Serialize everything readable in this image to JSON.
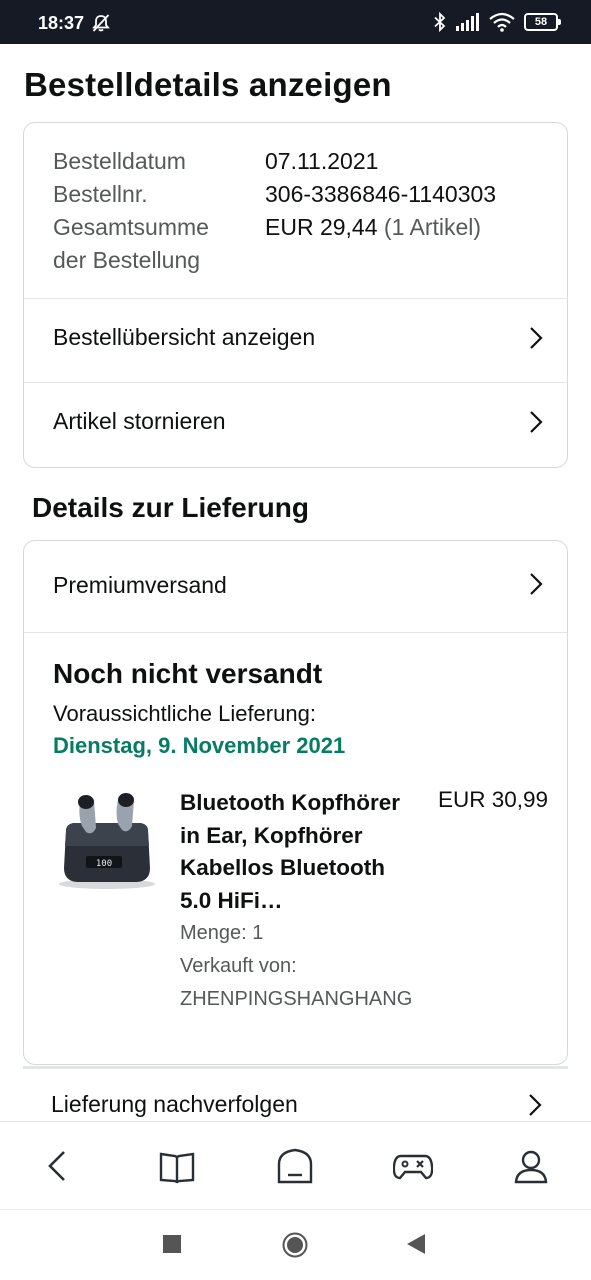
{
  "status_bar": {
    "time": "18:37",
    "battery": "58",
    "icons": [
      "bell-muted-icon",
      "bluetooth-icon",
      "signal-icon",
      "wifi-icon",
      "battery-icon"
    ]
  },
  "page": {
    "title": "Bestelldetails anzeigen"
  },
  "order_summary": {
    "date_label": "Bestelldatum",
    "date_value": "07.11.2021",
    "number_label": "Bestellnr.",
    "number_value": "306-3386846-1140303",
    "total_label": "Gesamtsumme der Bestellung",
    "total_value": "EUR 29,44",
    "total_items": "(1 Artikel)"
  },
  "order_actions": {
    "overview": "Bestellübersicht anzeigen",
    "cancel": "Artikel stornieren"
  },
  "delivery": {
    "section_title": "Details zur Lieferung",
    "shipping_method": "Premiumversand",
    "status": "Noch nicht versandt",
    "eta_label": "Voraussichtliche Lieferung:",
    "eta_date": "Dienstag, 9. November 2021",
    "eta_color": "#067d62",
    "item": {
      "title": "Bluetooth Kopfhörer in Ear, Kopfhörer Kabellos Bluetooth 5.0 HiFi…",
      "price": "EUR 30,99",
      "quantity": "Menge: 1",
      "sold_by_label": "Verkauft von:",
      "seller": "ZHENPINGSHANGHANG",
      "image_icon": "earbuds-product-image"
    },
    "track_label": "Lieferung nachverfolgen"
  },
  "bottom_nav": [
    "back-icon",
    "book-icon",
    "home-icon",
    "gamepad-icon",
    "profile-icon"
  ],
  "system_nav": [
    "recent-apps-icon",
    "home-circle-icon",
    "back-triangle-icon"
  ]
}
